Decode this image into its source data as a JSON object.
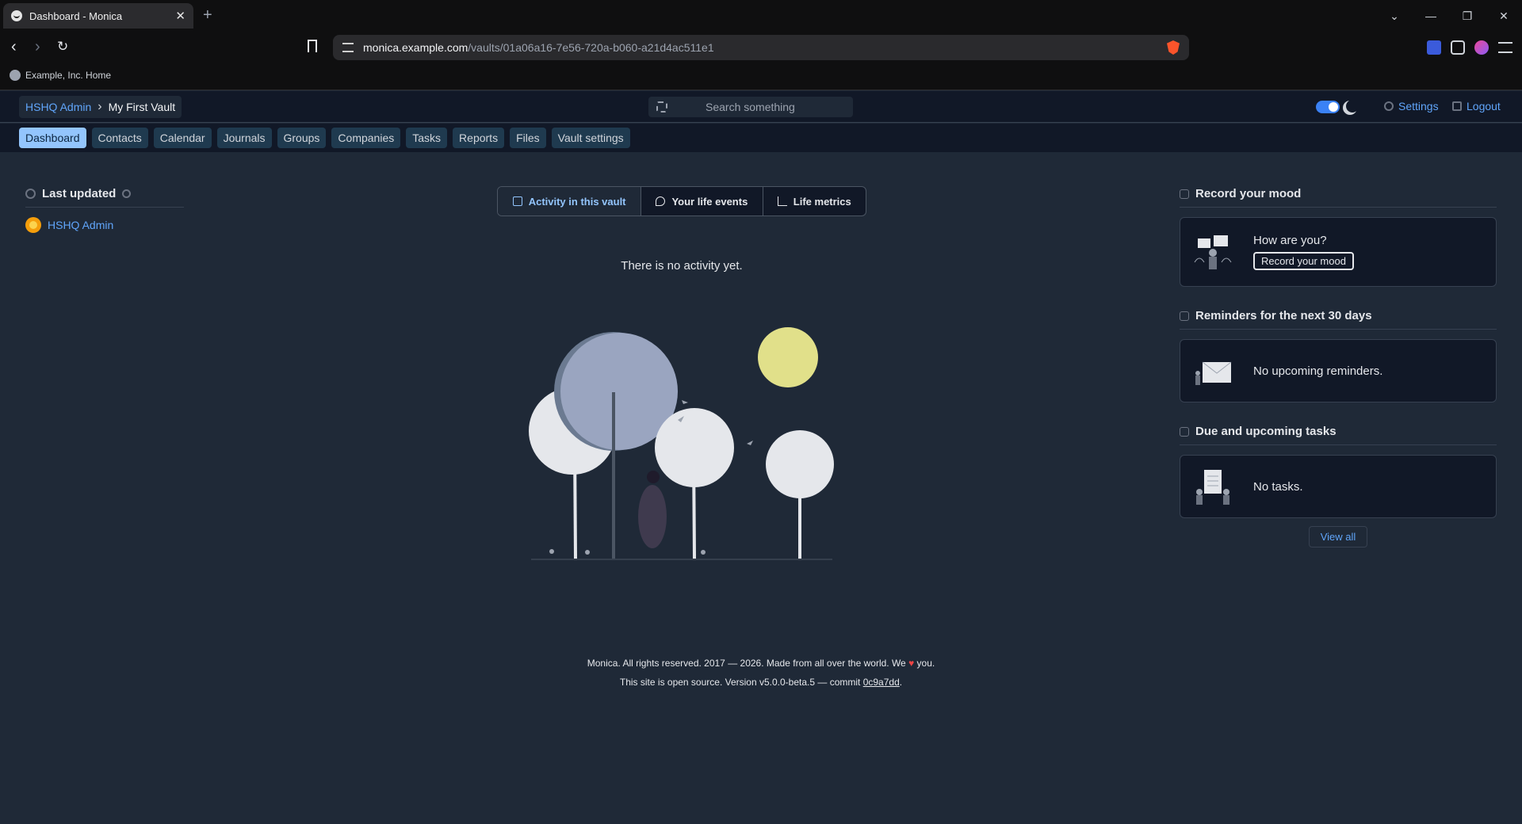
{
  "browser": {
    "tab_title": "Dashboard - Monica",
    "url_host": "monica.example.com",
    "url_path": "/vaults/01a06a16-7e56-720a-b060-a21d4ac511e1",
    "bookmark": "Example, Inc. Home"
  },
  "header": {
    "breadcrumb_user": "HSHQ Admin",
    "breadcrumb_vault": "My First Vault",
    "search_placeholder": "Search something",
    "settings": "Settings",
    "logout": "Logout"
  },
  "vault_nav": [
    "Dashboard",
    "Contacts",
    "Calendar",
    "Journals",
    "Groups",
    "Companies",
    "Tasks",
    "Reports",
    "Files",
    "Vault settings"
  ],
  "last_updated": {
    "title": "Last updated",
    "items": [
      "HSHQ Admin"
    ]
  },
  "center": {
    "tabs": [
      "Activity in this vault",
      "Your life events",
      "Life metrics"
    ],
    "empty": "There is no activity yet."
  },
  "mood": {
    "title": "Record your mood",
    "question": "How are you?",
    "button": "Record your mood"
  },
  "reminders": {
    "title": "Reminders for the next 30 days",
    "empty": "No upcoming reminders."
  },
  "tasks": {
    "title": "Due and upcoming tasks",
    "empty": "No tasks.",
    "view_all": "View all"
  },
  "footer": {
    "line1_a": "Monica. All rights reserved. 2017 — 2026. Made from all over the world. We",
    "heart": "♥",
    "line1_b": "you.",
    "line2_a": "This site is open source. Version v5.0.0-beta.5 — commit",
    "commit": "0c9a7dd",
    "line2_b": "."
  }
}
